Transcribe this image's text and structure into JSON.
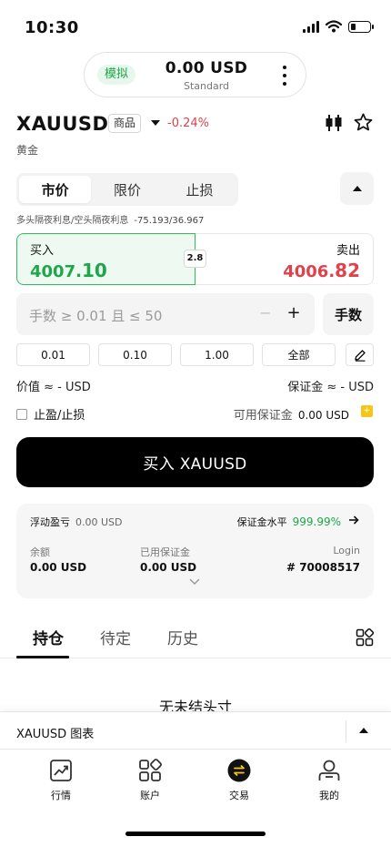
{
  "status": {
    "time": "10:30"
  },
  "account": {
    "mode": "模拟",
    "balance": "0.00 USD",
    "type": "Standard"
  },
  "symbol": {
    "code": "XAUUSD",
    "category": "商品",
    "change": "-0.24%",
    "name": "黄金"
  },
  "order_tabs": [
    "市价",
    "限价",
    "止损"
  ],
  "swap": {
    "label": "多头隔夜利息/空头隔夜利息",
    "value": "-75.193/36.967"
  },
  "quote": {
    "buy_label": "买入",
    "buy_price_main": "4007.",
    "buy_price_big": "10",
    "sell_label": "卖出",
    "sell_price_main": "4006.",
    "sell_price_big": "82",
    "spread": "2.8"
  },
  "lots": {
    "placeholder": "手数 ≥ 0.01 且 ≤ 50",
    "minus": "−",
    "plus": "+",
    "unit_button": "手数",
    "quick": [
      "0.01",
      "0.10",
      "1.00",
      "全部"
    ]
  },
  "values": {
    "value_label": "价值 ≈ - USD",
    "margin_label": "保证金 ≈ - USD",
    "sltp_label": "止盈/止损",
    "free_margin_label": "可用保证金",
    "free_margin_value": "0.00 USD"
  },
  "submit_label": "买入 XAUUSD",
  "summary": {
    "float_pl_label": "浮动盈亏",
    "float_pl_value": "0.00 USD",
    "margin_level_label": "保证金水平",
    "margin_level_value": "999.99%",
    "balance_label": "余额",
    "balance_value": "0.00 USD",
    "used_margin_label": "已用保证金",
    "used_margin_value": "0.00 USD",
    "login_label": "Login",
    "login_value": "# 70008517"
  },
  "position_tabs": [
    "持仓",
    "待定",
    "历史"
  ],
  "empty_text": "无未结头寸",
  "chart_bar": {
    "title": "XAUUSD 图表"
  },
  "tab_bar": [
    {
      "label": "行情",
      "icon": "chart-trend-icon"
    },
    {
      "label": "账户",
      "icon": "account-grid-icon"
    },
    {
      "label": "交易",
      "icon": "trade-swap-icon"
    },
    {
      "label": "我的",
      "icon": "profile-icon"
    }
  ],
  "colors": {
    "buy": "#1ea64a",
    "sell": "#e0424a",
    "accent": "#2cbf56"
  }
}
